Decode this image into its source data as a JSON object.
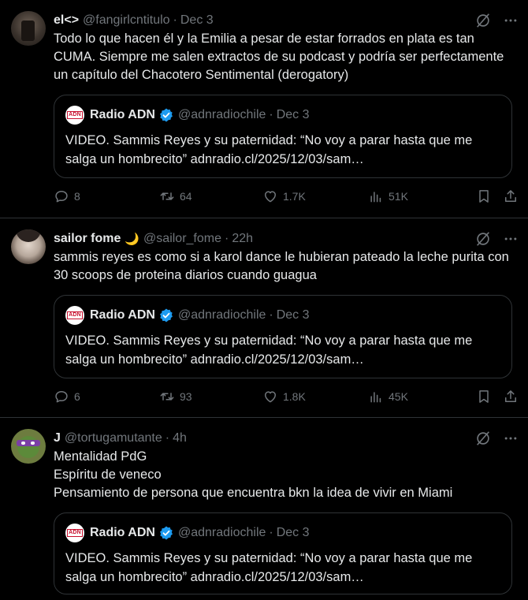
{
  "colors": {
    "background": "#000000",
    "text": "#e7e9ea",
    "muted": "#71767b",
    "border": "#2f3336",
    "verified": "#1d9bf0"
  },
  "tweets": [
    {
      "name": "el<>",
      "handle": "@fangirlcntitulo",
      "time": "Dec 3",
      "text": "Todo lo que hacen él y la Emilia a pesar de estar forrados en plata es tan CUMA. Siempre me salen extractos de su podcast y podría ser perfectamente un capítulo del Chacotero Sentimental (derogatory)",
      "quote": {
        "name": "Radio ADN",
        "handle": "@adnradiochile",
        "time": "Dec 3",
        "logo": "ADN",
        "text": "VIDEO. Sammis Reyes y su paternidad: “No voy a parar hasta que me salga un hombrecito” adnradio.cl/2025/12/03/sam…"
      },
      "replies": "8",
      "retweets": "64",
      "likes": "1.7K",
      "views": "51K"
    },
    {
      "name": "sailor fome",
      "emoji": "🌙",
      "handle": "@sailor_fome",
      "time": "22h",
      "text": "sammis reyes es como si a karol dance le hubieran pateado la leche purita con 30 scoops de proteina diarios cuando guagua",
      "quote": {
        "name": "Radio ADN",
        "handle": "@adnradiochile",
        "time": "Dec 3",
        "logo": "ADN",
        "text": "VIDEO. Sammis Reyes y su paternidad: “No voy a parar hasta que me salga un hombrecito” adnradio.cl/2025/12/03/sam…"
      },
      "replies": "6",
      "retweets": "93",
      "likes": "1.8K",
      "views": "45K"
    },
    {
      "name": "J",
      "handle": "@tortugamutante",
      "time": "4h",
      "text": "Mentalidad PdG\nEspíritu de veneco\nPensamiento de persona que encuentra bkn la idea de vivir en Miami",
      "quote": {
        "name": "Radio ADN",
        "handle": "@adnradiochile",
        "time": "Dec 3",
        "logo": "ADN",
        "text": "VIDEO. Sammis Reyes y su paternidad: “No voy a parar hasta que me salga un hombrecito” adnradio.cl/2025/12/03/sam…"
      }
    }
  ],
  "icons": {
    "grok": "grok-icon",
    "more": "more-icon",
    "reply": "reply-icon",
    "retweet": "retweet-icon",
    "like": "heart-icon",
    "views": "views-icon",
    "bookmark": "bookmark-icon",
    "share": "share-icon"
  }
}
